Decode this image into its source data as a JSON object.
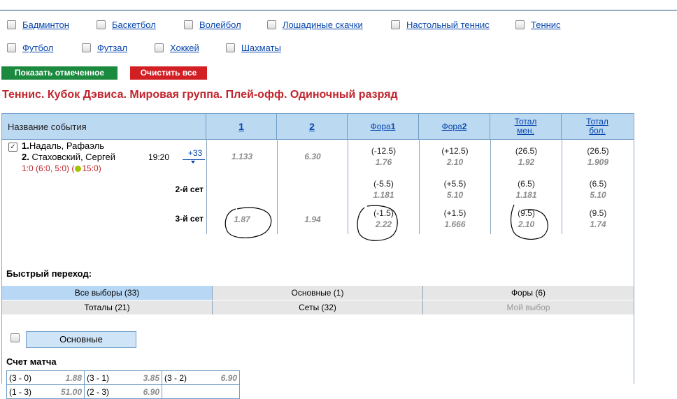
{
  "sports": [
    {
      "label": "Бадминтон"
    },
    {
      "label": "Баскетбол"
    },
    {
      "label": "Волейбол"
    },
    {
      "label": "Лошадиные скачки"
    },
    {
      "label": "Настольный теннис"
    },
    {
      "label": "Теннис"
    },
    {
      "label": "Футбол"
    },
    {
      "label": "Футзал"
    },
    {
      "label": "Хоккей"
    },
    {
      "label": "Шахматы"
    }
  ],
  "buttons": {
    "show_selected": "Показать отмеченное",
    "clear_all": "Очистить все"
  },
  "event_title": "Теннис. Кубок Дэвиса. Мировая группа. Плей-офф. Одиночный разряд",
  "table": {
    "headers": {
      "name": "Название события",
      "c1": "1",
      "c2": "2",
      "fora1_prefix": "Фора",
      "fora1_num": "1",
      "fora2_prefix": "Фора",
      "fora2_num": "2",
      "total_under": "Тотал мен.",
      "total_over": "Тотал бол."
    },
    "event": {
      "p1_num": "1.",
      "p1_name": "Надаль, Рафаэль",
      "p2_num": "2.",
      "p2_name": "Стаховский, Сергей",
      "score_before": "1:0 (6:0, 5:0) (",
      "score_after": "15:0)",
      "time": "19:20",
      "more": "+33",
      "rows": [
        {
          "label": "",
          "w1": "1.133",
          "w2": "6.30",
          "f1h": "(-12.5)",
          "f1v": "1.76",
          "f2h": "(+12.5)",
          "f2v": "2.10",
          "tuh": "(26.5)",
          "tuv": "1.92",
          "toh": "(26.5)",
          "tov": "1.909"
        },
        {
          "label": "2-й сет",
          "w1": "",
          "w2": "",
          "f1h": "(-5.5)",
          "f1v": "1.181",
          "f2h": "(+5.5)",
          "f2v": "5.10",
          "tuh": "(6.5)",
          "tuv": "1.181",
          "toh": "(6.5)",
          "tov": "5.10"
        },
        {
          "label": "3-й сет",
          "w1": "1.87",
          "w2": "1.94",
          "f1h": "(-1.5)",
          "f1v": "2.22",
          "f2h": "(+1.5)",
          "f2v": "1.666",
          "tuh": "(9.5)",
          "tuv": "2.10",
          "toh": "(9.5)",
          "tov": "1.74"
        }
      ]
    },
    "quick_nav": "Быстрый переход:",
    "filters_row1": [
      "Все выборы (33)",
      "Основные (1)",
      "Форы (6)"
    ],
    "filters_row2": [
      "Тоталы (21)",
      "Сеты (32)",
      "Мой выбор"
    ],
    "group_button": "Основные",
    "match_score_title": "Счет матча",
    "match_score": [
      [
        {
          "l": "(3 - 0)",
          "v": "1.88"
        },
        {
          "l": "(3 - 1)",
          "v": "3.85"
        },
        {
          "l": "(3 - 2)",
          "v": "6.90"
        }
      ],
      [
        {
          "l": "(1 - 3)",
          "v": "51.00"
        },
        {
          "l": "(2 - 3)",
          "v": "6.90"
        },
        {
          "l": "",
          "v": ""
        }
      ]
    ]
  },
  "colors": {
    "green_button": "#1b8a3f",
    "red_button": "#d21f24",
    "title_red": "#c0262d",
    "header_blue": "#bcd9f2",
    "link_blue": "#0645ad"
  }
}
